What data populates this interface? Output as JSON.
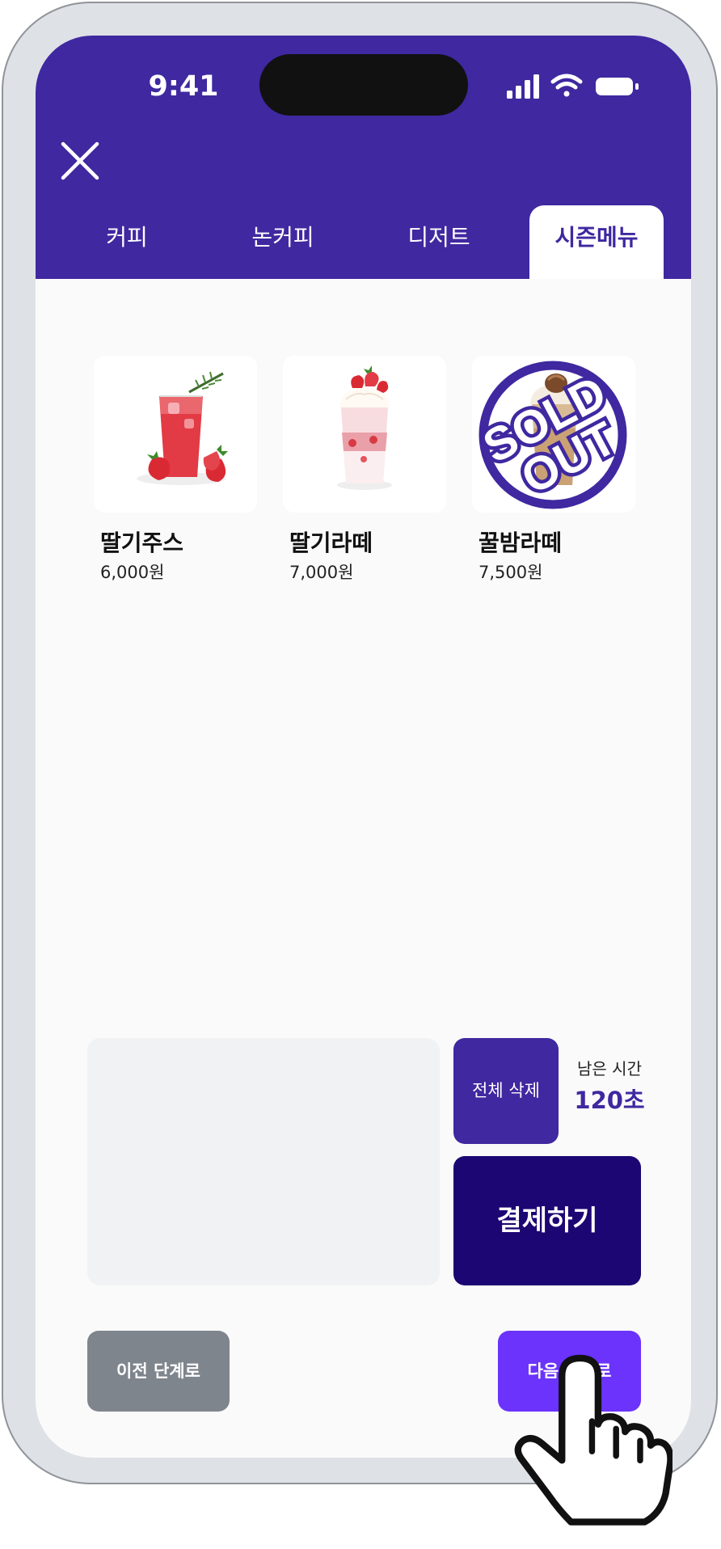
{
  "status_bar": {
    "time": "9:41"
  },
  "tabs": [
    {
      "label": "커피",
      "active": false
    },
    {
      "label": "논커피",
      "active": false
    },
    {
      "label": "디저트",
      "active": false
    },
    {
      "label": "시즌메뉴",
      "active": true
    }
  ],
  "products": [
    {
      "name": "딸기주스",
      "price": "6,000원",
      "image": "strawberry-juice",
      "sold_out": false
    },
    {
      "name": "딸기라떼",
      "price": "7,000원",
      "image": "strawberry-latte",
      "sold_out": false
    },
    {
      "name": "꿀밤라떼",
      "price": "7,500원",
      "image": "honey-chestnut-latte",
      "sold_out": true,
      "sold_out_label": "SOLD OUT"
    }
  ],
  "cart": {
    "clear_label": "전체 삭제",
    "timer_label": "남은 시간",
    "timer_value": "120초",
    "pay_label": "결제하기"
  },
  "navigation": {
    "prev_label": "이전 단계로",
    "next_label": "다음 단계로"
  },
  "colors": {
    "brand": "#3f28a0",
    "pay": "#1c0673",
    "next": "#6b33fb",
    "prev": "#7f858d"
  }
}
